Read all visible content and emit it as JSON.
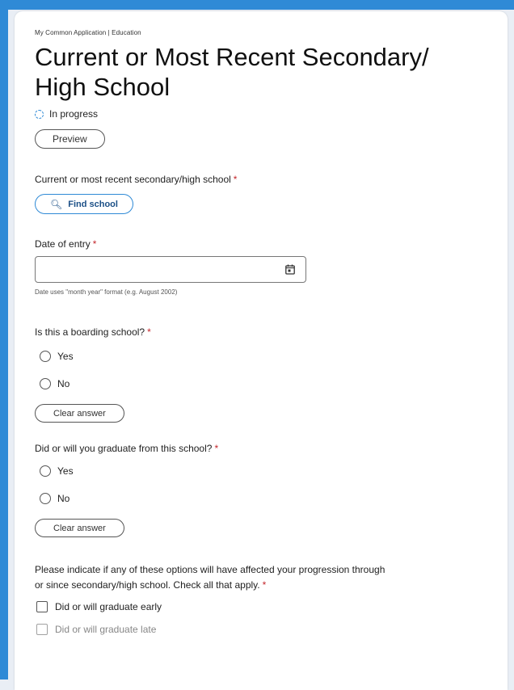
{
  "breadcrumb": "My Common Application | Education",
  "page_title": "Current or Most Recent Secondary/ High School",
  "status": {
    "label": "In progress",
    "icon": "dashed-circle-icon"
  },
  "buttons": {
    "preview": "Preview",
    "find_school": "Find school",
    "clear_answer_boarding": "Clear answer",
    "clear_answer_graduate": "Clear answer"
  },
  "fields": {
    "school_label": "Current or most recent secondary/high school",
    "date_label": "Date of entry",
    "date_value": "",
    "date_hint": "Date uses \"month year\" format (e.g. August 2002)",
    "required_mark": "*"
  },
  "questions": {
    "boarding": {
      "label": "Is this a boarding school?",
      "options": [
        "Yes",
        "No"
      ]
    },
    "graduate": {
      "label": "Did or will you graduate from this school?",
      "options": [
        "Yes",
        "No"
      ]
    },
    "progression": {
      "label": "Please indicate if any of these options will have affected your progression through or since secondary/high school. Check all that apply.",
      "options": [
        "Did or will graduate early",
        "Did or will graduate late"
      ]
    }
  },
  "colors": {
    "accent": "#2f8ad6",
    "required": "#c4272c",
    "link_text": "#1b4f86"
  }
}
